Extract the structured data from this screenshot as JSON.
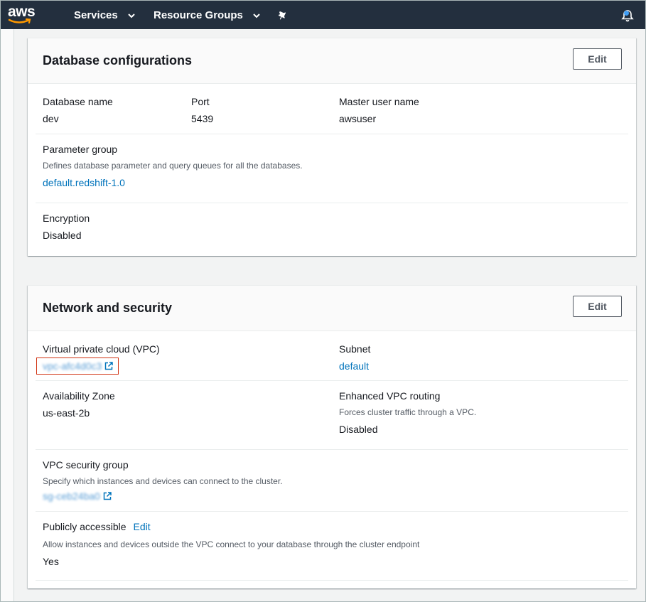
{
  "nav": {
    "services": "Services",
    "resource_groups": "Resource Groups",
    "logo_text": "aws"
  },
  "database": {
    "title": "Database configurations",
    "edit_label": "Edit",
    "db_name_label": "Database name",
    "db_name_value": "dev",
    "port_label": "Port",
    "port_value": "5439",
    "master_user_label": "Master user name",
    "master_user_value": "awsuser",
    "param_group_label": "Parameter group",
    "param_group_desc": "Defines database parameter and query queues for all the databases.",
    "param_group_value": "default.redshift-1.0",
    "encryption_label": "Encryption",
    "encryption_value": "Disabled"
  },
  "network": {
    "title": "Network and security",
    "edit_label": "Edit",
    "vpc_label": "Virtual private cloud (VPC)",
    "vpc_value": "vpc-afc4d0c3",
    "subnet_label": "Subnet",
    "subnet_value": "default",
    "az_label": "Availability Zone",
    "az_value": "us-east-2b",
    "enhanced_label": "Enhanced VPC routing",
    "enhanced_desc": "Forces cluster traffic through a VPC.",
    "enhanced_value": "Disabled",
    "sg_label": "VPC security group",
    "sg_desc": "Specify which instances and devices can connect to the cluster.",
    "sg_value": "sg-ceb24ba0",
    "public_label": "Publicly accessible",
    "public_edit": "Edit",
    "public_desc": "Allow instances and devices outside the VPC connect to your database through the cluster endpoint",
    "public_value": "Yes"
  },
  "colors": {
    "nav_bg": "#232f3e",
    "link": "#0073bb",
    "highlight": "#d13212",
    "notification_dot": "#3f9df4"
  }
}
